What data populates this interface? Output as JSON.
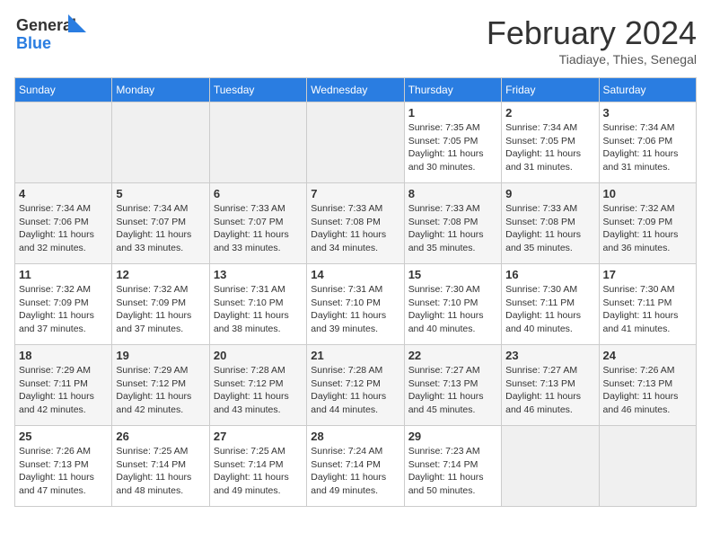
{
  "header": {
    "logo_line1": "General",
    "logo_line2": "Blue",
    "month": "February 2024",
    "location": "Tiadiaye, Thies, Senegal"
  },
  "days_of_week": [
    "Sunday",
    "Monday",
    "Tuesday",
    "Wednesday",
    "Thursday",
    "Friday",
    "Saturday"
  ],
  "weeks": [
    [
      {
        "day": "",
        "info": ""
      },
      {
        "day": "",
        "info": ""
      },
      {
        "day": "",
        "info": ""
      },
      {
        "day": "",
        "info": ""
      },
      {
        "day": "1",
        "info": "Sunrise: 7:35 AM\nSunset: 7:05 PM\nDaylight: 11 hours\nand 30 minutes."
      },
      {
        "day": "2",
        "info": "Sunrise: 7:34 AM\nSunset: 7:05 PM\nDaylight: 11 hours\nand 31 minutes."
      },
      {
        "day": "3",
        "info": "Sunrise: 7:34 AM\nSunset: 7:06 PM\nDaylight: 11 hours\nand 31 minutes."
      }
    ],
    [
      {
        "day": "4",
        "info": "Sunrise: 7:34 AM\nSunset: 7:06 PM\nDaylight: 11 hours\nand 32 minutes."
      },
      {
        "day": "5",
        "info": "Sunrise: 7:34 AM\nSunset: 7:07 PM\nDaylight: 11 hours\nand 33 minutes."
      },
      {
        "day": "6",
        "info": "Sunrise: 7:33 AM\nSunset: 7:07 PM\nDaylight: 11 hours\nand 33 minutes."
      },
      {
        "day": "7",
        "info": "Sunrise: 7:33 AM\nSunset: 7:08 PM\nDaylight: 11 hours\nand 34 minutes."
      },
      {
        "day": "8",
        "info": "Sunrise: 7:33 AM\nSunset: 7:08 PM\nDaylight: 11 hours\nand 35 minutes."
      },
      {
        "day": "9",
        "info": "Sunrise: 7:33 AM\nSunset: 7:08 PM\nDaylight: 11 hours\nand 35 minutes."
      },
      {
        "day": "10",
        "info": "Sunrise: 7:32 AM\nSunset: 7:09 PM\nDaylight: 11 hours\nand 36 minutes."
      }
    ],
    [
      {
        "day": "11",
        "info": "Sunrise: 7:32 AM\nSunset: 7:09 PM\nDaylight: 11 hours\nand 37 minutes."
      },
      {
        "day": "12",
        "info": "Sunrise: 7:32 AM\nSunset: 7:09 PM\nDaylight: 11 hours\nand 37 minutes."
      },
      {
        "day": "13",
        "info": "Sunrise: 7:31 AM\nSunset: 7:10 PM\nDaylight: 11 hours\nand 38 minutes."
      },
      {
        "day": "14",
        "info": "Sunrise: 7:31 AM\nSunset: 7:10 PM\nDaylight: 11 hours\nand 39 minutes."
      },
      {
        "day": "15",
        "info": "Sunrise: 7:30 AM\nSunset: 7:10 PM\nDaylight: 11 hours\nand 40 minutes."
      },
      {
        "day": "16",
        "info": "Sunrise: 7:30 AM\nSunset: 7:11 PM\nDaylight: 11 hours\nand 40 minutes."
      },
      {
        "day": "17",
        "info": "Sunrise: 7:30 AM\nSunset: 7:11 PM\nDaylight: 11 hours\nand 41 minutes."
      }
    ],
    [
      {
        "day": "18",
        "info": "Sunrise: 7:29 AM\nSunset: 7:11 PM\nDaylight: 11 hours\nand 42 minutes."
      },
      {
        "day": "19",
        "info": "Sunrise: 7:29 AM\nSunset: 7:12 PM\nDaylight: 11 hours\nand 42 minutes."
      },
      {
        "day": "20",
        "info": "Sunrise: 7:28 AM\nSunset: 7:12 PM\nDaylight: 11 hours\nand 43 minutes."
      },
      {
        "day": "21",
        "info": "Sunrise: 7:28 AM\nSunset: 7:12 PM\nDaylight: 11 hours\nand 44 minutes."
      },
      {
        "day": "22",
        "info": "Sunrise: 7:27 AM\nSunset: 7:13 PM\nDaylight: 11 hours\nand 45 minutes."
      },
      {
        "day": "23",
        "info": "Sunrise: 7:27 AM\nSunset: 7:13 PM\nDaylight: 11 hours\nand 46 minutes."
      },
      {
        "day": "24",
        "info": "Sunrise: 7:26 AM\nSunset: 7:13 PM\nDaylight: 11 hours\nand 46 minutes."
      }
    ],
    [
      {
        "day": "25",
        "info": "Sunrise: 7:26 AM\nSunset: 7:13 PM\nDaylight: 11 hours\nand 47 minutes."
      },
      {
        "day": "26",
        "info": "Sunrise: 7:25 AM\nSunset: 7:14 PM\nDaylight: 11 hours\nand 48 minutes."
      },
      {
        "day": "27",
        "info": "Sunrise: 7:25 AM\nSunset: 7:14 PM\nDaylight: 11 hours\nand 49 minutes."
      },
      {
        "day": "28",
        "info": "Sunrise: 7:24 AM\nSunset: 7:14 PM\nDaylight: 11 hours\nand 49 minutes."
      },
      {
        "day": "29",
        "info": "Sunrise: 7:23 AM\nSunset: 7:14 PM\nDaylight: 11 hours\nand 50 minutes."
      },
      {
        "day": "",
        "info": ""
      },
      {
        "day": "",
        "info": ""
      }
    ]
  ]
}
